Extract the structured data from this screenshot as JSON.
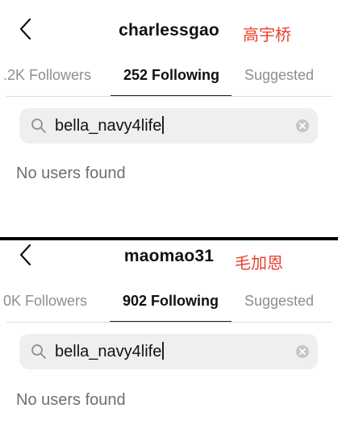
{
  "panels": [
    {
      "username": "charlessgao",
      "annotation": "高宇桥",
      "tabs": {
        "followers": ".2K Followers",
        "following": "252 Following",
        "suggested": "Suggested"
      },
      "search_value": "bella_navy4life",
      "empty_message": "No users found"
    },
    {
      "username": "maomao31",
      "annotation": "毛加恩",
      "tabs": {
        "followers": "0K Followers",
        "following": "902 Following",
        "suggested": "Suggested"
      },
      "search_value": "bella_navy4life",
      "empty_message": "No users found"
    }
  ],
  "colors": {
    "annotation": "#e8402a",
    "inactive_tab": "#8e8e8e",
    "search_bg": "#efefef"
  },
  "icons": {
    "back": "chevron-left-icon",
    "search": "search-icon",
    "clear": "clear-circle-icon"
  }
}
